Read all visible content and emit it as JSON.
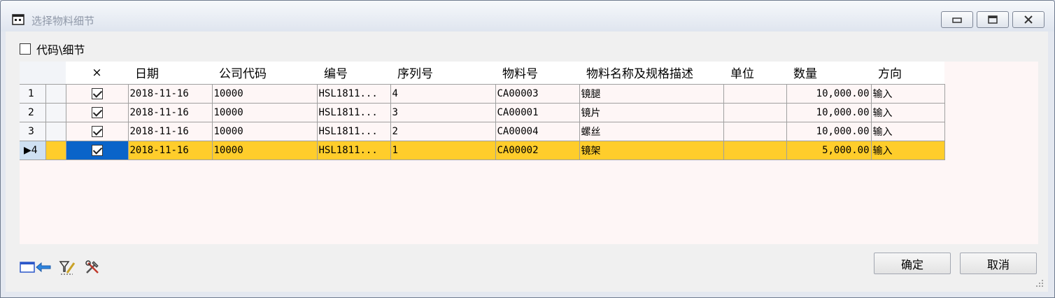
{
  "window": {
    "title": "选择物料细节",
    "minimize_icon": "minimize-icon",
    "maximize_icon": "maximize-icon",
    "close_icon": "close-icon"
  },
  "toolbar": {
    "checkbox_label": "代码\\细节",
    "checkbox_checked": false
  },
  "grid": {
    "columns": [
      "×",
      "日期",
      "公司代码",
      "编号",
      "序列号",
      "物料号",
      "物料名称及规格描述",
      "单位",
      "数量",
      "方向"
    ],
    "rows": [
      {
        "row_num": "1",
        "checked": true,
        "date": "2018-11-16",
        "company": "10000",
        "number": "HSL1811...",
        "serial": "4",
        "material": "CA00003",
        "desc": "镜腿",
        "unit": "",
        "qty": "10,000.00",
        "direction": "输入"
      },
      {
        "row_num": "2",
        "checked": true,
        "date": "2018-11-16",
        "company": "10000",
        "number": "HSL1811...",
        "serial": "3",
        "material": "CA00001",
        "desc": "镜片",
        "unit": "",
        "qty": "10,000.00",
        "direction": "输入"
      },
      {
        "row_num": "3",
        "checked": true,
        "date": "2018-11-16",
        "company": "10000",
        "number": "HSL1811...",
        "serial": "2",
        "material": "CA00004",
        "desc": "螺丝",
        "unit": "",
        "qty": "10,000.00",
        "direction": "输入"
      },
      {
        "row_num": "▶4",
        "checked": true,
        "date": "2018-11-16",
        "company": "10000",
        "number": "HSL1811...",
        "serial": "1",
        "material": "CA00002",
        "desc": "镜架",
        "unit": "",
        "qty": "5,000.00",
        "direction": "输入"
      }
    ],
    "selected_row": 3,
    "colors": {
      "selected_row": "#ffcd2b",
      "selected_check_cell": "#0a64c9",
      "grid_bg": "#fef6f6"
    }
  },
  "footer": {
    "icons": [
      "window-arrow-icon",
      "filter-icon",
      "tools-icon"
    ],
    "confirm_label": "确定",
    "cancel_label": "取消"
  }
}
